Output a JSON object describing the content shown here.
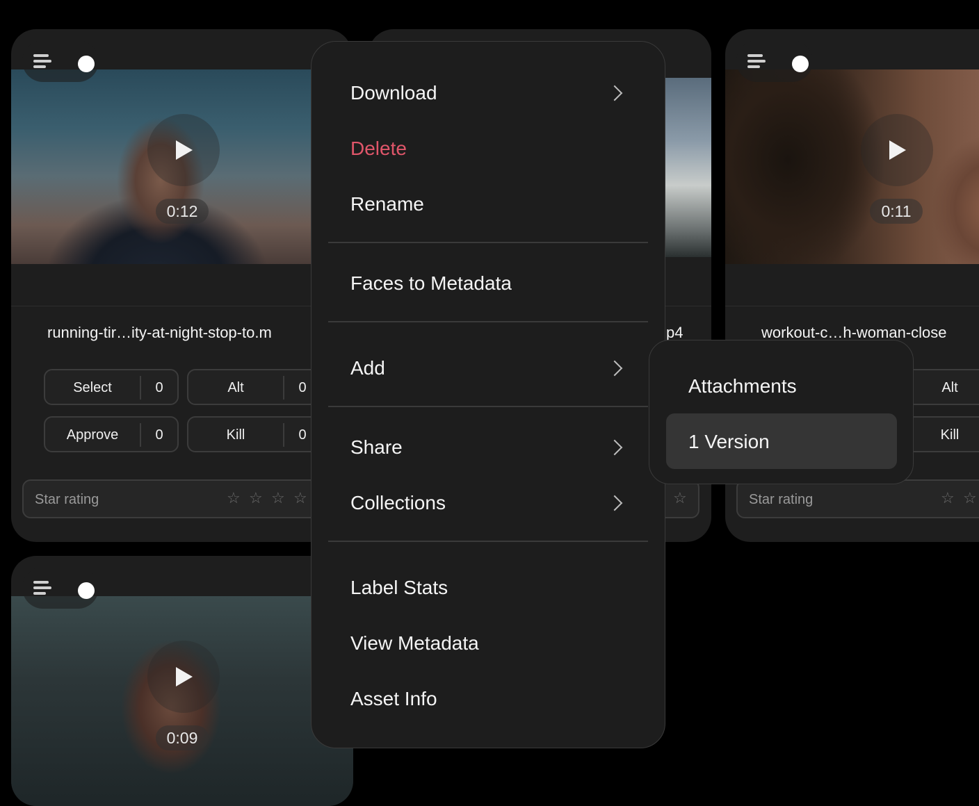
{
  "cards": [
    {
      "filename": "running-tir…ity-at-night-stop-to.m",
      "duration": "0:12",
      "buttons": [
        {
          "label": "Select",
          "count": "0"
        },
        {
          "label": "Alt",
          "count": "0"
        },
        {
          "label": "Approve",
          "count": "0"
        },
        {
          "label": "Kill",
          "count": "0"
        }
      ],
      "star_rating_label": "Star rating"
    },
    {
      "filename": "p4"
    },
    {
      "filename": "workout-c…h-woman-close",
      "duration": "0:11",
      "buttons": [
        {
          "label": "Alt"
        },
        {
          "label": "Kill"
        }
      ],
      "star_rating_label": "Star rating"
    },
    {
      "duration": "0:09"
    }
  ],
  "context_menu": {
    "items": [
      {
        "label": "Download",
        "has_submenu": true
      },
      {
        "label": "Delete",
        "danger": true
      },
      {
        "label": "Rename"
      },
      {
        "label": "Faces to Metadata"
      },
      {
        "label": "Add",
        "has_submenu": true
      },
      {
        "label": "Share",
        "has_submenu": true
      },
      {
        "label": "Collections",
        "has_submenu": true
      },
      {
        "label": "Label Stats"
      },
      {
        "label": "View Metadata"
      },
      {
        "label": "Asset Info"
      }
    ]
  },
  "submenu": {
    "items": [
      {
        "label": "Attachments"
      },
      {
        "label": "1 Version",
        "highlighted": true
      }
    ]
  },
  "colors": {
    "danger": "#e0566a",
    "background": "#000000",
    "card": "#1e1e1e",
    "highlight": "#353535"
  }
}
